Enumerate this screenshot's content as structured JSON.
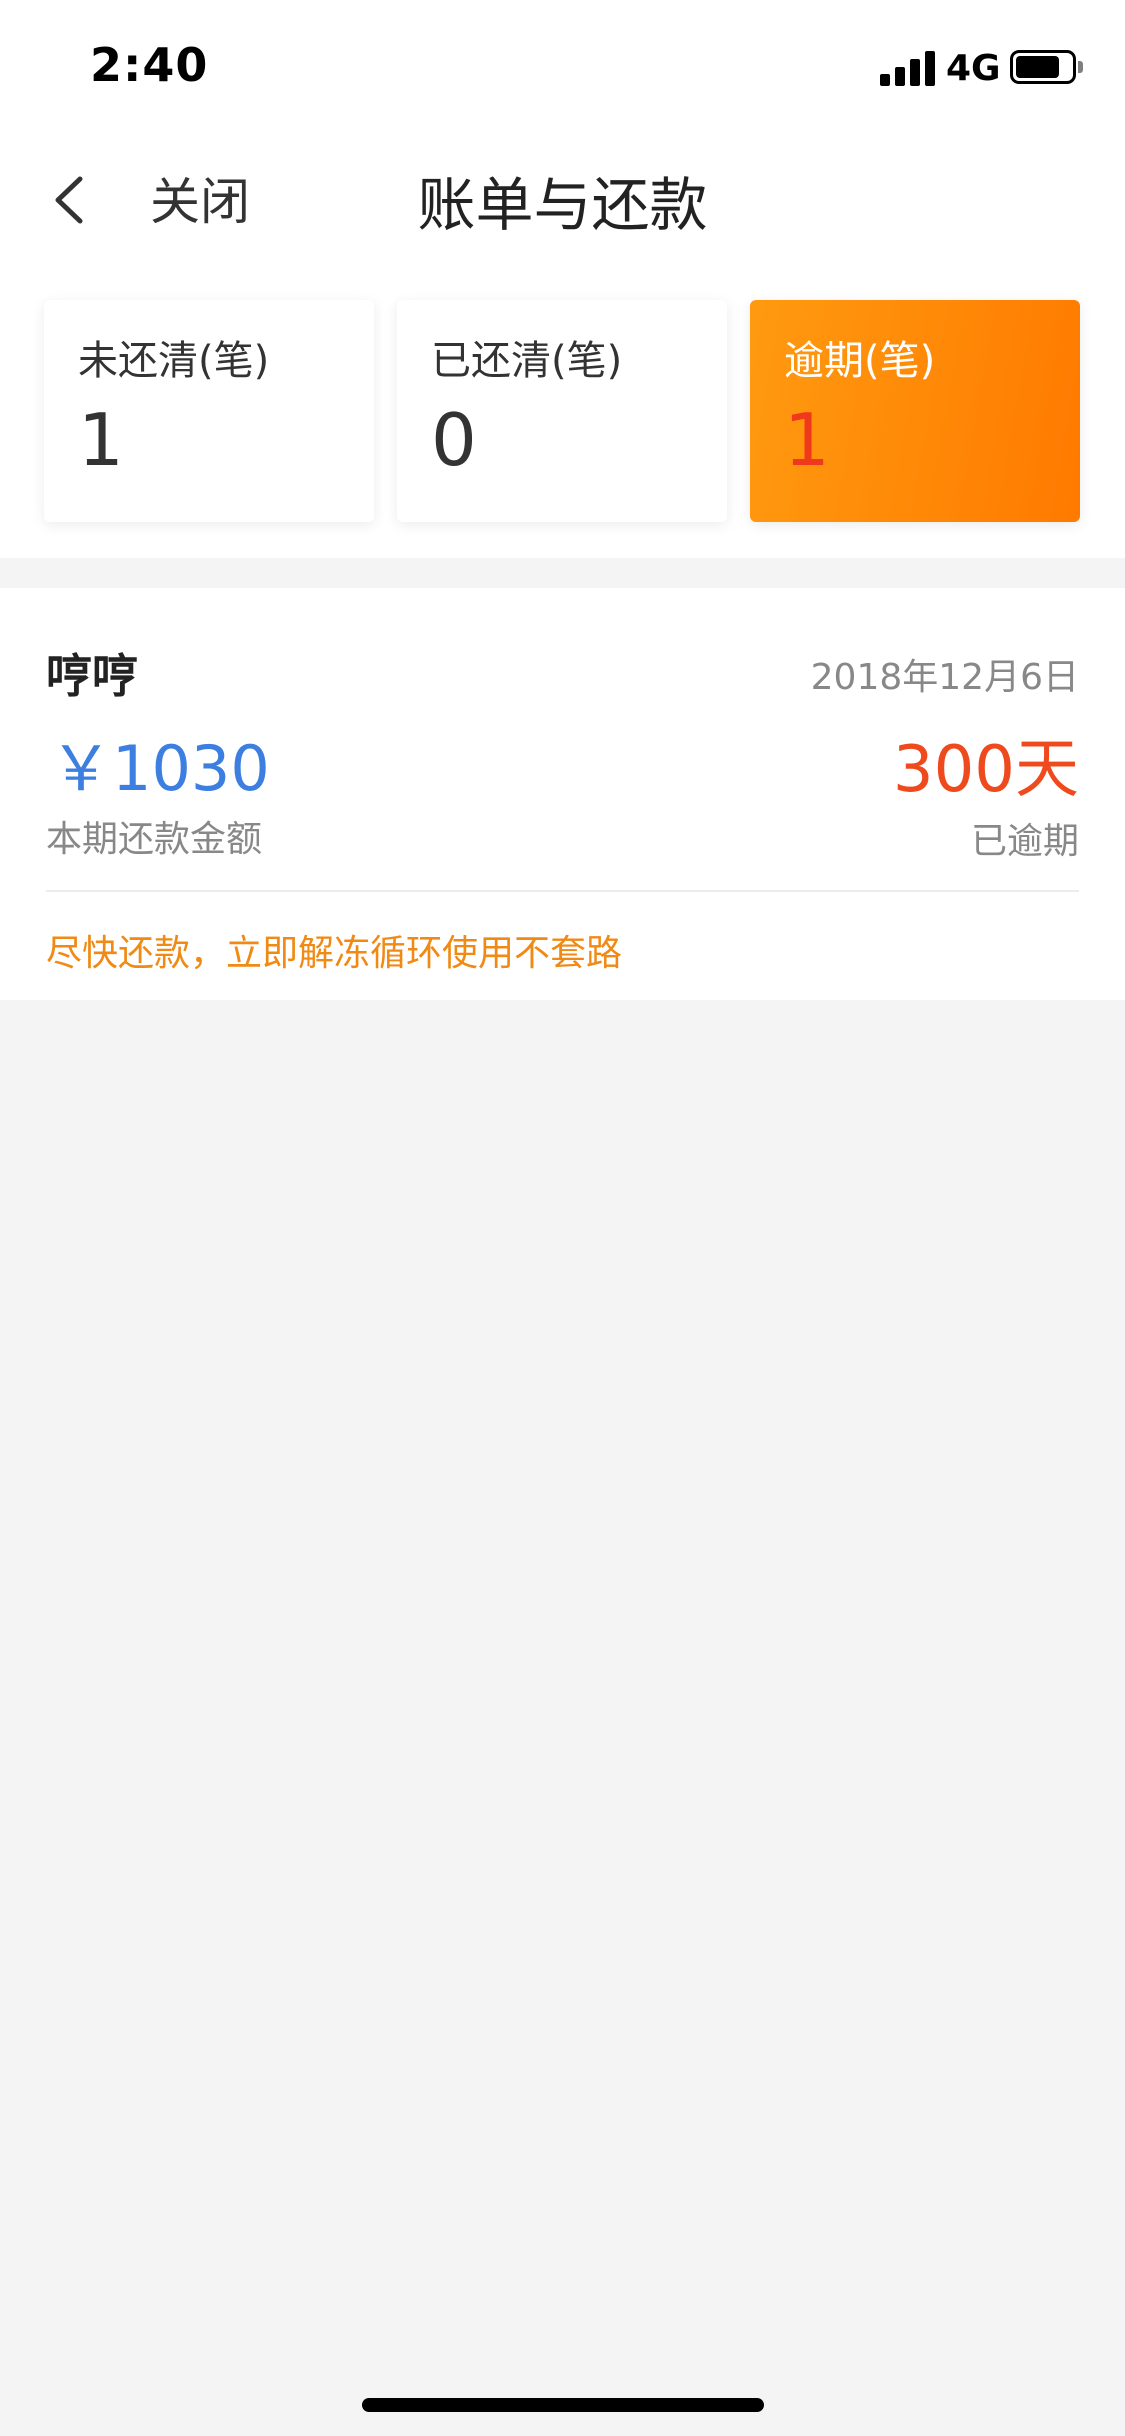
{
  "status_bar": {
    "time": "2:40",
    "network": "4G",
    "battery_level": 0.8,
    "icons": [
      "signal-icon",
      "battery-icon"
    ]
  },
  "nav": {
    "back_icon": "chevron-left-icon",
    "close_label": "关闭",
    "title": "账单与还款"
  },
  "summary": {
    "cards": [
      {
        "label": "未还清(笔)",
        "value": "1"
      },
      {
        "label": "已还清(笔)",
        "value": "0"
      },
      {
        "label": "逾期(笔)",
        "value": "1"
      }
    ]
  },
  "bill": {
    "name": "哼哼",
    "date": "2018年12月6日",
    "amount": "￥1030",
    "amount_label": "本期还款金额",
    "overdue_days": "300天",
    "overdue_label": "已逾期",
    "tip": "尽快还款，立即解冻循环使用不套路"
  },
  "colors": {
    "accent_blue": "#3d7fe0",
    "overdue_red": "#ef4a1d",
    "tip_orange": "#f08a14",
    "overdue_card_gradient_start": "#ff9a10",
    "overdue_card_gradient_end": "#ff7a00",
    "page_background": "#f4f4f4"
  }
}
